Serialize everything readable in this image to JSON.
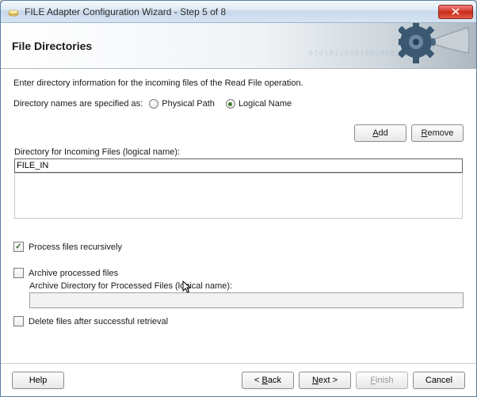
{
  "window": {
    "title": "FILE Adapter Configuration Wizard - Step 5 of 8"
  },
  "header": {
    "title": "File Directories"
  },
  "intro": "Enter directory information for the incoming files of the Read File operation.",
  "spec": {
    "label": "Directory names are specified as:",
    "options": {
      "physical": "Physical Path",
      "logical": "Logical Name"
    }
  },
  "toolbar": {
    "add": "Add",
    "remove": "Remove"
  },
  "dir": {
    "label": "Directory for Incoming Files (logical name):",
    "value": "FILE_IN"
  },
  "checks": {
    "recursive": "Process files recursively",
    "archive": "Archive processed files",
    "archive_sub_label": "Archive Directory for Processed Files (logical name):",
    "delete": "Delete files after successful retrieval"
  },
  "footer": {
    "help": "Help",
    "back": "< Back",
    "next": "Next >",
    "finish": "Finish",
    "cancel": "Cancel"
  }
}
